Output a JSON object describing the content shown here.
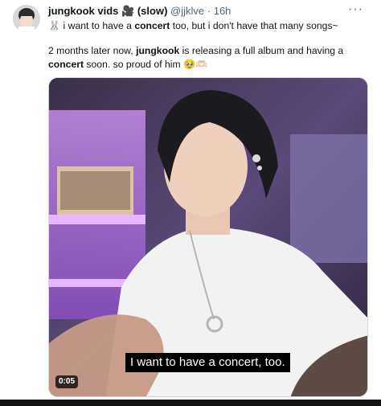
{
  "tweet": {
    "author_name": "jungkook vids",
    "author_emoji": "🎥",
    "author_suffix": "(slow)",
    "handle": "@jjklve",
    "separator": "·",
    "time": "16h",
    "more_icon": "more-horizontal-icon",
    "line1_prefix": "🐰 i want to have a ",
    "line1_bold": "concert",
    "line1_suffix": " too, but i don't have that many songs~",
    "line2_a": "2 months later now, ",
    "line2_bold1": "jungkook",
    "line2_b": " is releasing a full album and having a",
    "line2_bold2": "concert",
    "line2_c": " soon. so proud of him 🥹🫶🏻"
  },
  "video": {
    "caption": "I want to have a concert, too.",
    "timestamp": "0:05"
  },
  "colors": {
    "handle_gray": "#536471",
    "border": "#cfd9de"
  }
}
